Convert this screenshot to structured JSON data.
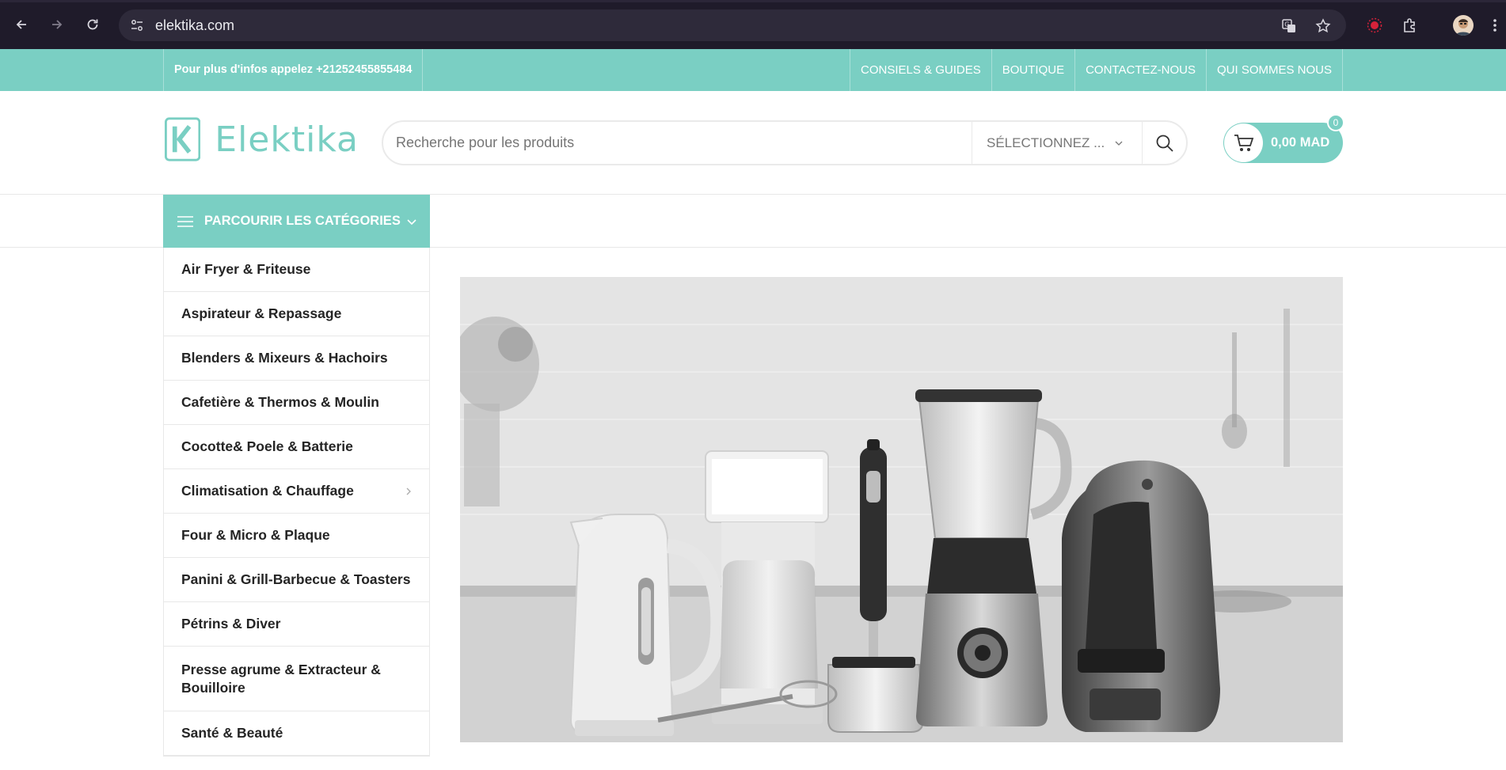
{
  "browser": {
    "url": "elektika.com"
  },
  "infobar": {
    "phone_text": "Pour plus d'infos appelez +21252455855484",
    "links": [
      "CONSIELS & GUIDES",
      "BOUTIQUE",
      "CONTACTEZ-NOUS",
      "QUI SOMMES NOUS"
    ]
  },
  "header": {
    "logo_text": "Elektika",
    "search_placeholder": "Recherche pour les produits",
    "category_select": "SÉLECTIONNEZ ...",
    "cart_total": "0,00 MAD",
    "cart_count": "0"
  },
  "categories": {
    "toggle_label": "PARCOURIR LES CATÉGORIES",
    "items": [
      "Air Fryer & Friteuse",
      "Aspirateur & Repassage",
      "Blenders & Mixeurs & Hachoirs",
      "Cafetière & Thermos & Moulin",
      "Cocotte& Poele & Batterie",
      "Climatisation & Chauffage",
      "Four & Micro & Plaque",
      "Panini & Grill-Barbecue & Toasters",
      "Pétrins & Diver",
      "Presse agrume & Extracteur & Bouilloire",
      "Santé & Beauté"
    ]
  },
  "colors": {
    "brand": "#7acfc3",
    "chrome": "#1f1b2a"
  },
  "icons": {
    "back": "arrow-left-icon",
    "forward": "arrow-right-icon",
    "reload": "reload-icon",
    "site_info": "site-settings-icon",
    "translate": "translate-icon",
    "bookmark": "star-icon",
    "extension": "puzzle-icon",
    "search": "search-icon",
    "cart": "cart-icon",
    "menu": "hamburger-icon"
  }
}
